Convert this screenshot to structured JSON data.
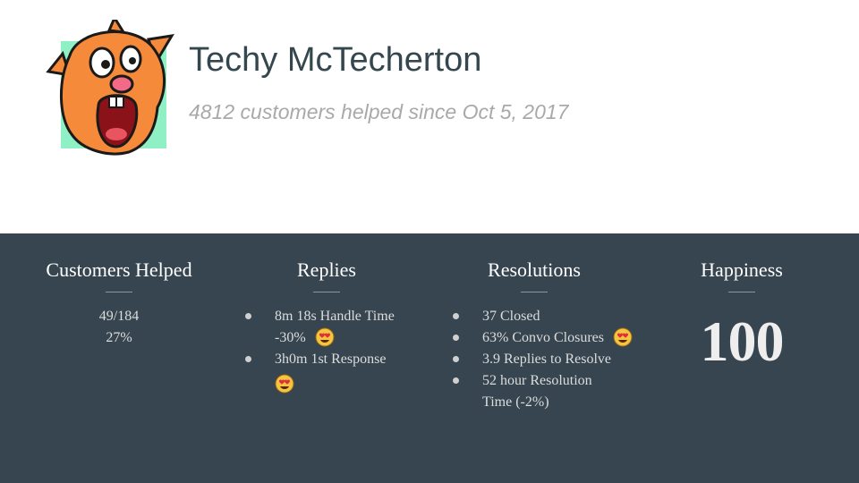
{
  "profile": {
    "name": "Techy McTecherton",
    "subtitle": "4812 customers helped since Oct 5, 2017",
    "avatar_bg_color": "#8ef0c4",
    "avatar_icon": "cartoon-squirrel-avatar"
  },
  "stats": {
    "background_color": "#36454f",
    "customers": {
      "title": "Customers Helped",
      "lines": [
        "49/184",
        "27%"
      ]
    },
    "replies": {
      "title": "Replies",
      "items": [
        {
          "text_line1": "8m 18s Handle Time",
          "text_line2": "-30%",
          "emoji": "heart-eyes-emoji"
        },
        {
          "text_line1": "3h0m 1st Response",
          "emoji": "heart-eyes-emoji"
        }
      ]
    },
    "resolutions": {
      "title": "Resolutions",
      "items": [
        {
          "text": "37 Closed"
        },
        {
          "text": "63% Convo Closures",
          "emoji": "heart-eyes-emoji"
        },
        {
          "text": "3.9 Replies to Resolve"
        },
        {
          "text_line1": "52 hour Resolution",
          "text_line2": "Time (-2%)"
        }
      ]
    },
    "happiness": {
      "title": "Happiness",
      "value": "100"
    }
  }
}
